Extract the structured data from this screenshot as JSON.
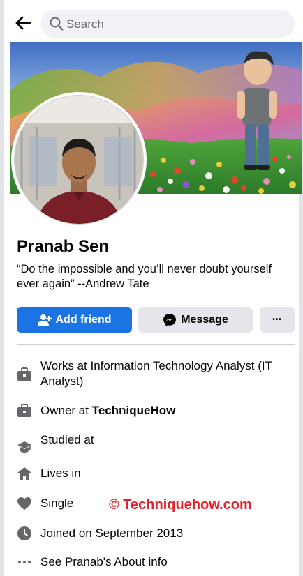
{
  "search": {
    "placeholder": "Search"
  },
  "profile": {
    "name": "Pranab Sen",
    "bio": "“Do the impossible and you’ll never doubt yourself ever again” --Andrew Tate"
  },
  "actions": {
    "add_friend": "Add friend",
    "message": "Message",
    "more": "•••"
  },
  "details": [
    {
      "icon": "briefcase-icon",
      "text": "Works at Information Technology Analyst (IT Analyst)"
    },
    {
      "icon": "briefcase-icon",
      "prefix": "Owner at ",
      "bold": "TechniqueHow"
    },
    {
      "icon": "graduation-cap-icon",
      "text": "Studied at"
    },
    {
      "icon": "home-icon",
      "text": "Lives in"
    },
    {
      "icon": "heart-icon",
      "text": "Single"
    },
    {
      "icon": "clock-icon",
      "text": "Joined on September 2013"
    },
    {
      "icon": "more-dots-icon",
      "text": "See Pranab's About info"
    }
  ],
  "watermark": "© Techniquehow.com",
  "colors": {
    "primary": "#1b74e4",
    "secondary_button": "#e4e6eb",
    "icon_gray": "#65676b",
    "watermark": "#e3232c"
  }
}
